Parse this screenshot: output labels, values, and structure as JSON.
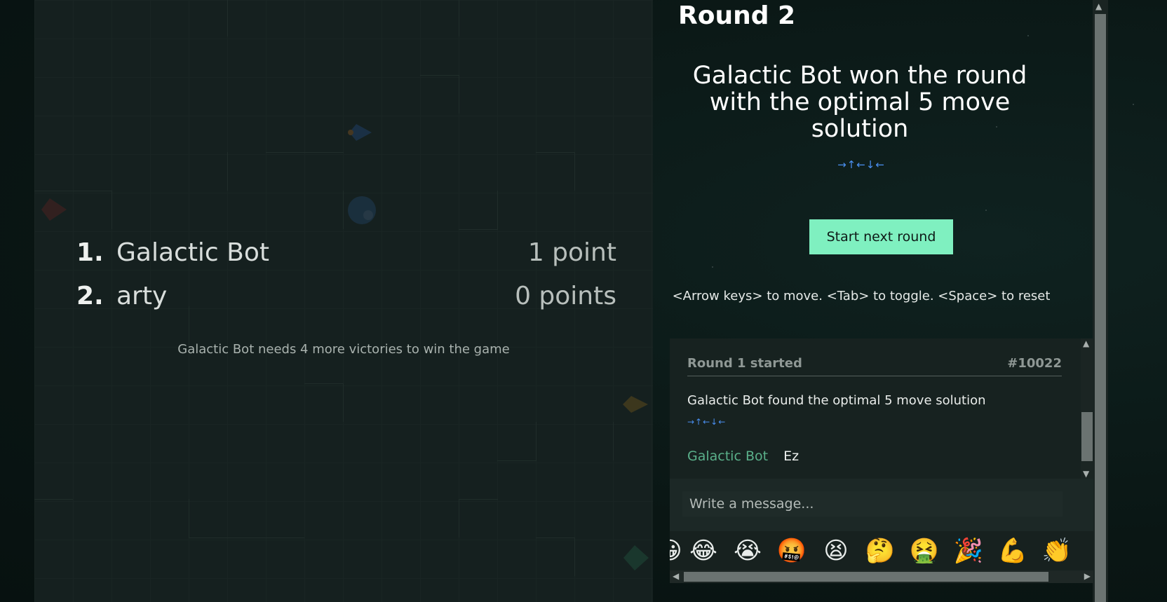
{
  "round": {
    "title": "Round 2",
    "winner_message": "Galactic Bot won the round with the optimal 5 move solution",
    "solution_arrows": "→↑←↓←",
    "next_button_label": "Start next round",
    "help_text": "<Arrow keys> to move. <Tab> to toggle. <Space> to reset"
  },
  "scoreboard": {
    "players": [
      {
        "rank": "1.",
        "name": "Galactic Bot",
        "points": "1 point"
      },
      {
        "rank": "2.",
        "name": "arty",
        "points": "0 points"
      }
    ],
    "note": "Galactic Bot needs 4 more victories to win the game"
  },
  "chat": {
    "round_header": "Round 1 started",
    "game_id": "#10022",
    "found_message": "Galactic Bot found the optimal 5 move solution",
    "found_arrows": "→↑←↓←",
    "messages": [
      {
        "author": "Galactic Bot",
        "text": "Ez"
      }
    ],
    "input_placeholder": "Write a message..."
  },
  "emojis": [
    "😂",
    "😭",
    "🤬",
    "😫",
    "🤔",
    "🤮",
    "🎉",
    "💪",
    "👏"
  ],
  "colors": {
    "accent_button": "#7ff0c0",
    "arrow_blue": "#4a8ff0",
    "chat_author": "#5ab08a"
  },
  "icons": {
    "pieces": [
      "rocket-icon",
      "ship-icon",
      "planet-icon"
    ]
  }
}
